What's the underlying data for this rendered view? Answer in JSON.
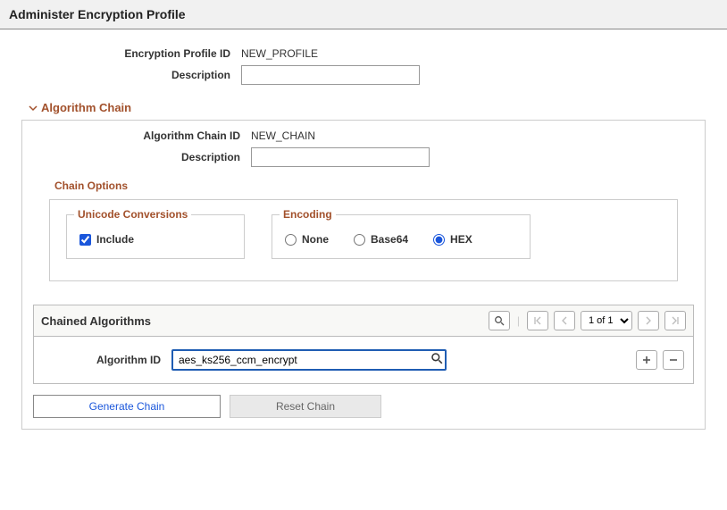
{
  "page": {
    "title": "Administer Encryption Profile"
  },
  "profile": {
    "id_label": "Encryption Profile ID",
    "id_value": "NEW_PROFILE",
    "description_label": "Description",
    "description_value": ""
  },
  "algorithm_chain_section": {
    "heading": "Algorithm Chain",
    "chain_id_label": "Algorithm Chain ID",
    "chain_id_value": "NEW_CHAIN",
    "description_label": "Description",
    "description_value": ""
  },
  "chain_options": {
    "heading": "Chain Options",
    "unicode": {
      "legend": "Unicode Conversions",
      "include_label": "Include",
      "include_checked": true
    },
    "encoding": {
      "legend": "Encoding",
      "options": [
        {
          "label": "None",
          "value": "none",
          "checked": false
        },
        {
          "label": "Base64",
          "value": "base64",
          "checked": false
        },
        {
          "label": "HEX",
          "value": "hex",
          "checked": true
        }
      ]
    }
  },
  "chained_algorithms": {
    "heading": "Chained Algorithms",
    "pager": {
      "display": "1 of 1"
    },
    "row": {
      "algorithm_id_label": "Algorithm ID",
      "algorithm_id_value": "aes_ks256_ccm_encrypt"
    }
  },
  "buttons": {
    "generate": "Generate Chain",
    "reset": "Reset Chain"
  }
}
